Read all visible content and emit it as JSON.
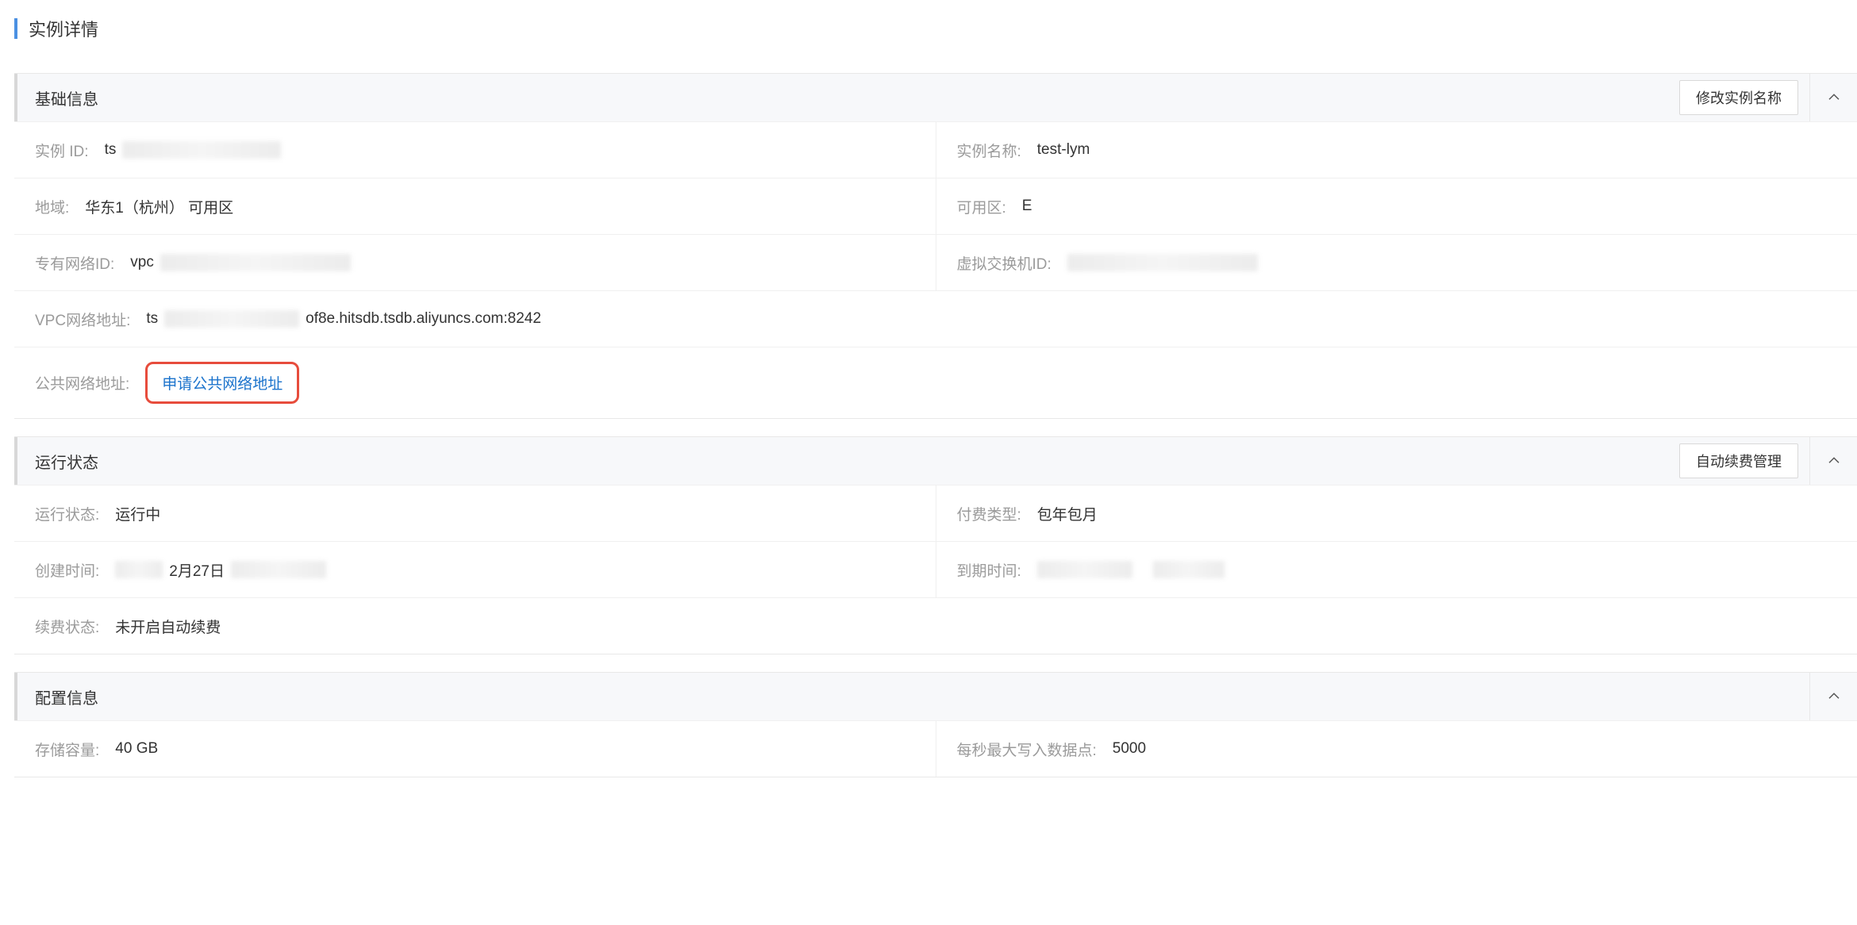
{
  "page": {
    "title": "实例详情"
  },
  "basic": {
    "header": "基础信息",
    "rename_btn": "修改实例名称",
    "instance_id_label": "实例 ID:",
    "instance_id_prefix": "ts",
    "instance_name_label": "实例名称:",
    "instance_name": "test-lym",
    "region_label": "地域:",
    "region": "华东1（杭州） 可用区",
    "zone_label": "可用区:",
    "zone": "E",
    "vpc_id_label": "专有网络ID:",
    "vpc_id_prefix": "vpc",
    "vswitch_label": "虚拟交换机ID:",
    "vpc_addr_label": "VPC网络地址:",
    "vpc_addr_prefix": "ts",
    "vpc_addr_suffix": "of8e.hitsdb.tsdb.aliyuncs.com:8242",
    "public_addr_label": "公共网络地址:",
    "public_addr_link": "申请公共网络地址"
  },
  "status": {
    "header": "运行状态",
    "renew_btn": "自动续费管理",
    "run_status_label": "运行状态:",
    "run_status": "运行中",
    "pay_type_label": "付费类型:",
    "pay_type": "包年包月",
    "create_time_label": "创建时间:",
    "create_time_visible": "2月27日",
    "expire_time_label": "到期时间:",
    "renew_status_label": "续费状态:",
    "renew_status": "未开启自动续费"
  },
  "config": {
    "header": "配置信息",
    "storage_label": "存储容量:",
    "storage": "40 GB",
    "max_write_label": "每秒最大写入数据点:",
    "max_write": "5000"
  }
}
